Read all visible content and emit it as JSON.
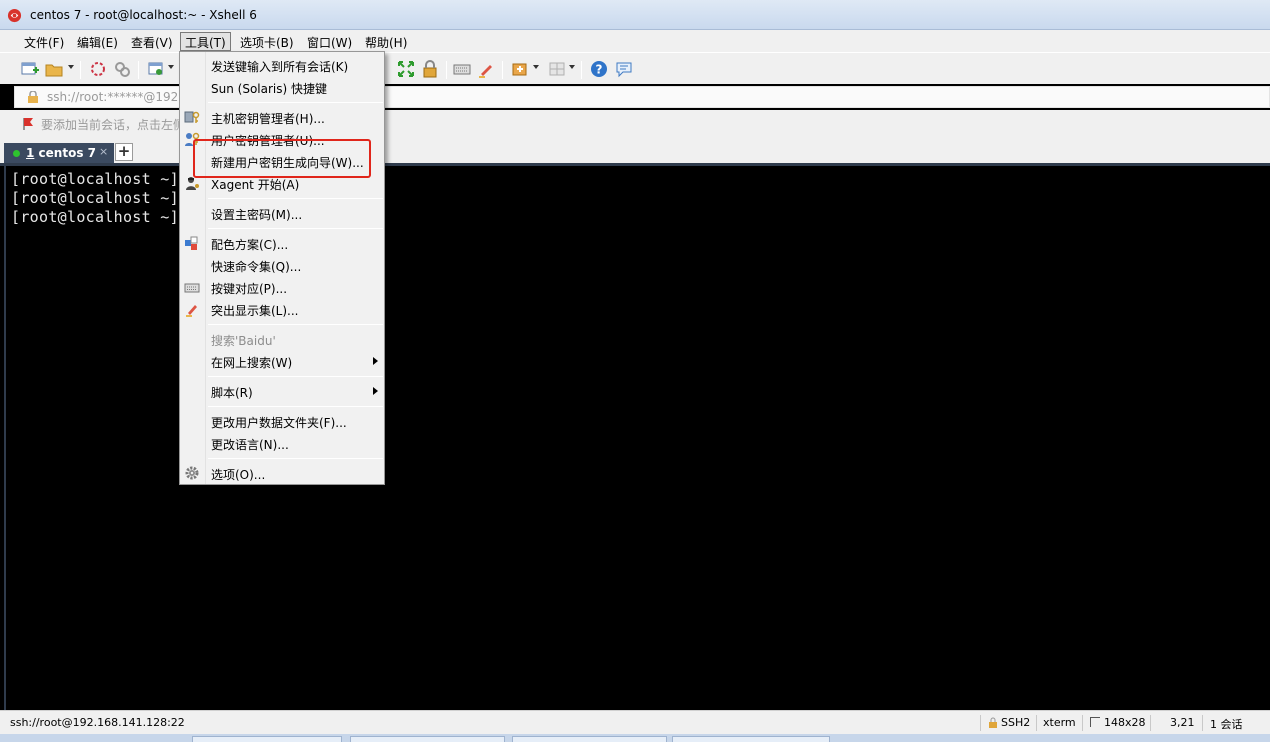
{
  "window": {
    "title": "centos 7 - root@localhost:~ - Xshell 6"
  },
  "menubar": {
    "items": [
      "文件(F)",
      "编辑(E)",
      "查看(V)",
      "工具(T)",
      "选项卡(B)",
      "窗口(W)",
      "帮助(H)"
    ],
    "active": "工具(T)"
  },
  "toolbar": {
    "icons": [
      "new-session-icon",
      "open-folder-icon",
      "disconnect-icon",
      "reconnect-icon",
      "new-window-icon",
      "fullscreen-icon",
      "lock-icon",
      "keyboard-icon",
      "highlight-icon",
      "add-tab-icon",
      "layout-icon",
      "help-icon",
      "chat-icon"
    ]
  },
  "addressbar": {
    "value": "ssh://root:******@192.1"
  },
  "hintbar": {
    "text": "要添加当前会话，点击左侧"
  },
  "tabs": [
    {
      "number": "1",
      "label": "centos 7",
      "close": "×"
    }
  ],
  "new_tab": "+",
  "terminal": {
    "lines": [
      "[root@localhost ~]#",
      "[root@localhost ~]#",
      "[root@localhost ~]#"
    ]
  },
  "tools_menu": {
    "items": [
      {
        "label": "发送键输入到所有会话(K)",
        "icon": ""
      },
      {
        "label": "Sun (Solaris) 快捷键",
        "icon": ""
      },
      {
        "label": "主机密钥管理者(H)...",
        "icon": "host-key-icon"
      },
      {
        "label": "用户密钥管理者(U)...",
        "icon": "user-key-icon"
      },
      {
        "label": "新建用户密钥生成向导(W)...",
        "icon": ""
      },
      {
        "label": "Xagent 开始(A)",
        "icon": "agent-icon"
      },
      {
        "label": "设置主密码(M)...",
        "icon": ""
      },
      {
        "label": "配色方案(C)...",
        "icon": "color-scheme-icon"
      },
      {
        "label": "快速命令集(Q)...",
        "icon": ""
      },
      {
        "label": "按键对应(P)...",
        "icon": "keyboard-icon"
      },
      {
        "label": "突出显示集(L)...",
        "icon": "highlight-pen-icon"
      },
      {
        "label": "搜索'Baidu'",
        "icon": "",
        "disabled": true
      },
      {
        "label": "在网上搜索(W)",
        "icon": "",
        "submenu": true
      },
      {
        "label": "脚本(R)",
        "icon": "",
        "submenu": true
      },
      {
        "label": "更改用户数据文件夹(F)...",
        "icon": ""
      },
      {
        "label": "更改语言(N)...",
        "icon": ""
      },
      {
        "label": "选项(O)...",
        "icon": "gear-icon"
      }
    ],
    "highlighted": "新建用户密钥生成向导(W)..."
  },
  "statusbar": {
    "connection": "ssh://root@192.168.141.128:22",
    "protocol": "SSH2",
    "terminal_type": "xterm",
    "size": "148x28",
    "cursor": "3,21",
    "sessions": "1 会话"
  },
  "colors": {
    "highlight_box": "#e0261b",
    "terminal_bg": "#000000",
    "tab_bg": "#3b4a60"
  }
}
